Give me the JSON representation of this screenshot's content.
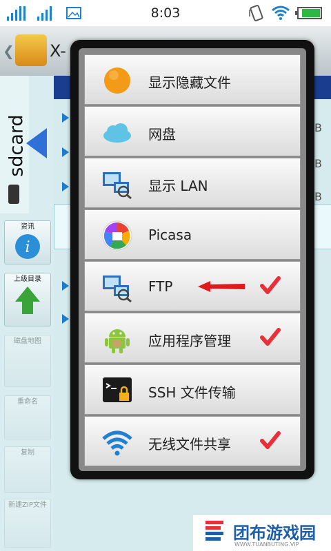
{
  "status_bar": {
    "time": "8:03"
  },
  "app": {
    "title": "X-"
  },
  "sidebar": {
    "location": "sdcard",
    "buttons": [
      {
        "label": "资讯",
        "enabled": true
      },
      {
        "label": "上级目录",
        "enabled": true
      },
      {
        "label": "磁盘地图",
        "enabled": false
      },
      {
        "label": "重命名",
        "enabled": false
      },
      {
        "label": "复制",
        "enabled": false
      },
      {
        "label": "新建ZIP文件",
        "enabled": false
      }
    ]
  },
  "file_list": {
    "sizes": [
      "B",
      "B",
      "B"
    ]
  },
  "menu": {
    "items": [
      {
        "label": "显示隐藏文件",
        "icon": "orange-circle-icon",
        "checked": false
      },
      {
        "label": "网盘",
        "icon": "cloud-icon",
        "checked": false
      },
      {
        "label": "显示 LAN",
        "icon": "network-computer-icon",
        "checked": false
      },
      {
        "label": "Picasa",
        "icon": "picasa-icon",
        "checked": false
      },
      {
        "label": "FTP",
        "icon": "ftp-computer-icon",
        "checked": true
      },
      {
        "label": "应用程序管理",
        "icon": "android-icon",
        "checked": true
      },
      {
        "label": "SSH 文件传输",
        "icon": "terminal-lock-icon",
        "checked": false
      },
      {
        "label": "无线文件共享",
        "icon": "wifi-icon",
        "checked": true
      }
    ]
  },
  "watermark": {
    "text": "团布游戏园",
    "url": "WWW.TUANBUTING.VIP"
  },
  "colors": {
    "check": "#e8303a",
    "accent": "#2e6fd8",
    "arrow": "#e0191c"
  }
}
